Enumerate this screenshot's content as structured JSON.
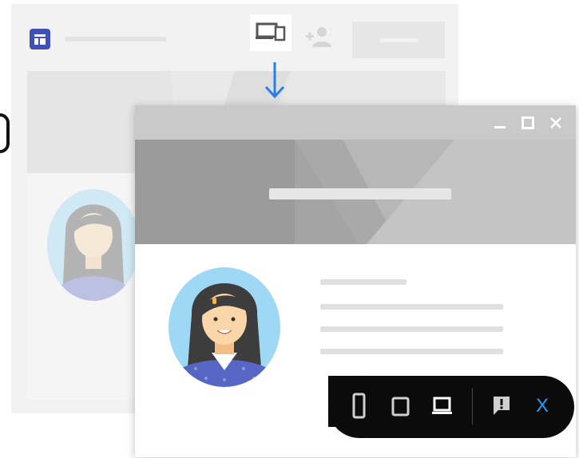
{
  "toolbar": {
    "close_label": "X"
  },
  "colors": {
    "accent_blue": "#3f51b5",
    "arrow_blue": "#2b7de9",
    "toolbar_bg": "#0b0b0b",
    "close_blue": "#2d9cf0"
  },
  "icons": {
    "app": "dashboard-icon",
    "devices": "devices-icon",
    "add_user": "person-add-icon",
    "arrow": "arrow-down-icon",
    "minimize": "minimize-icon",
    "maximize": "maximize-icon",
    "close": "close-icon",
    "phone": "phone-icon",
    "tablet": "tablet-icon",
    "laptop": "laptop-icon",
    "feedback": "feedback-icon"
  }
}
